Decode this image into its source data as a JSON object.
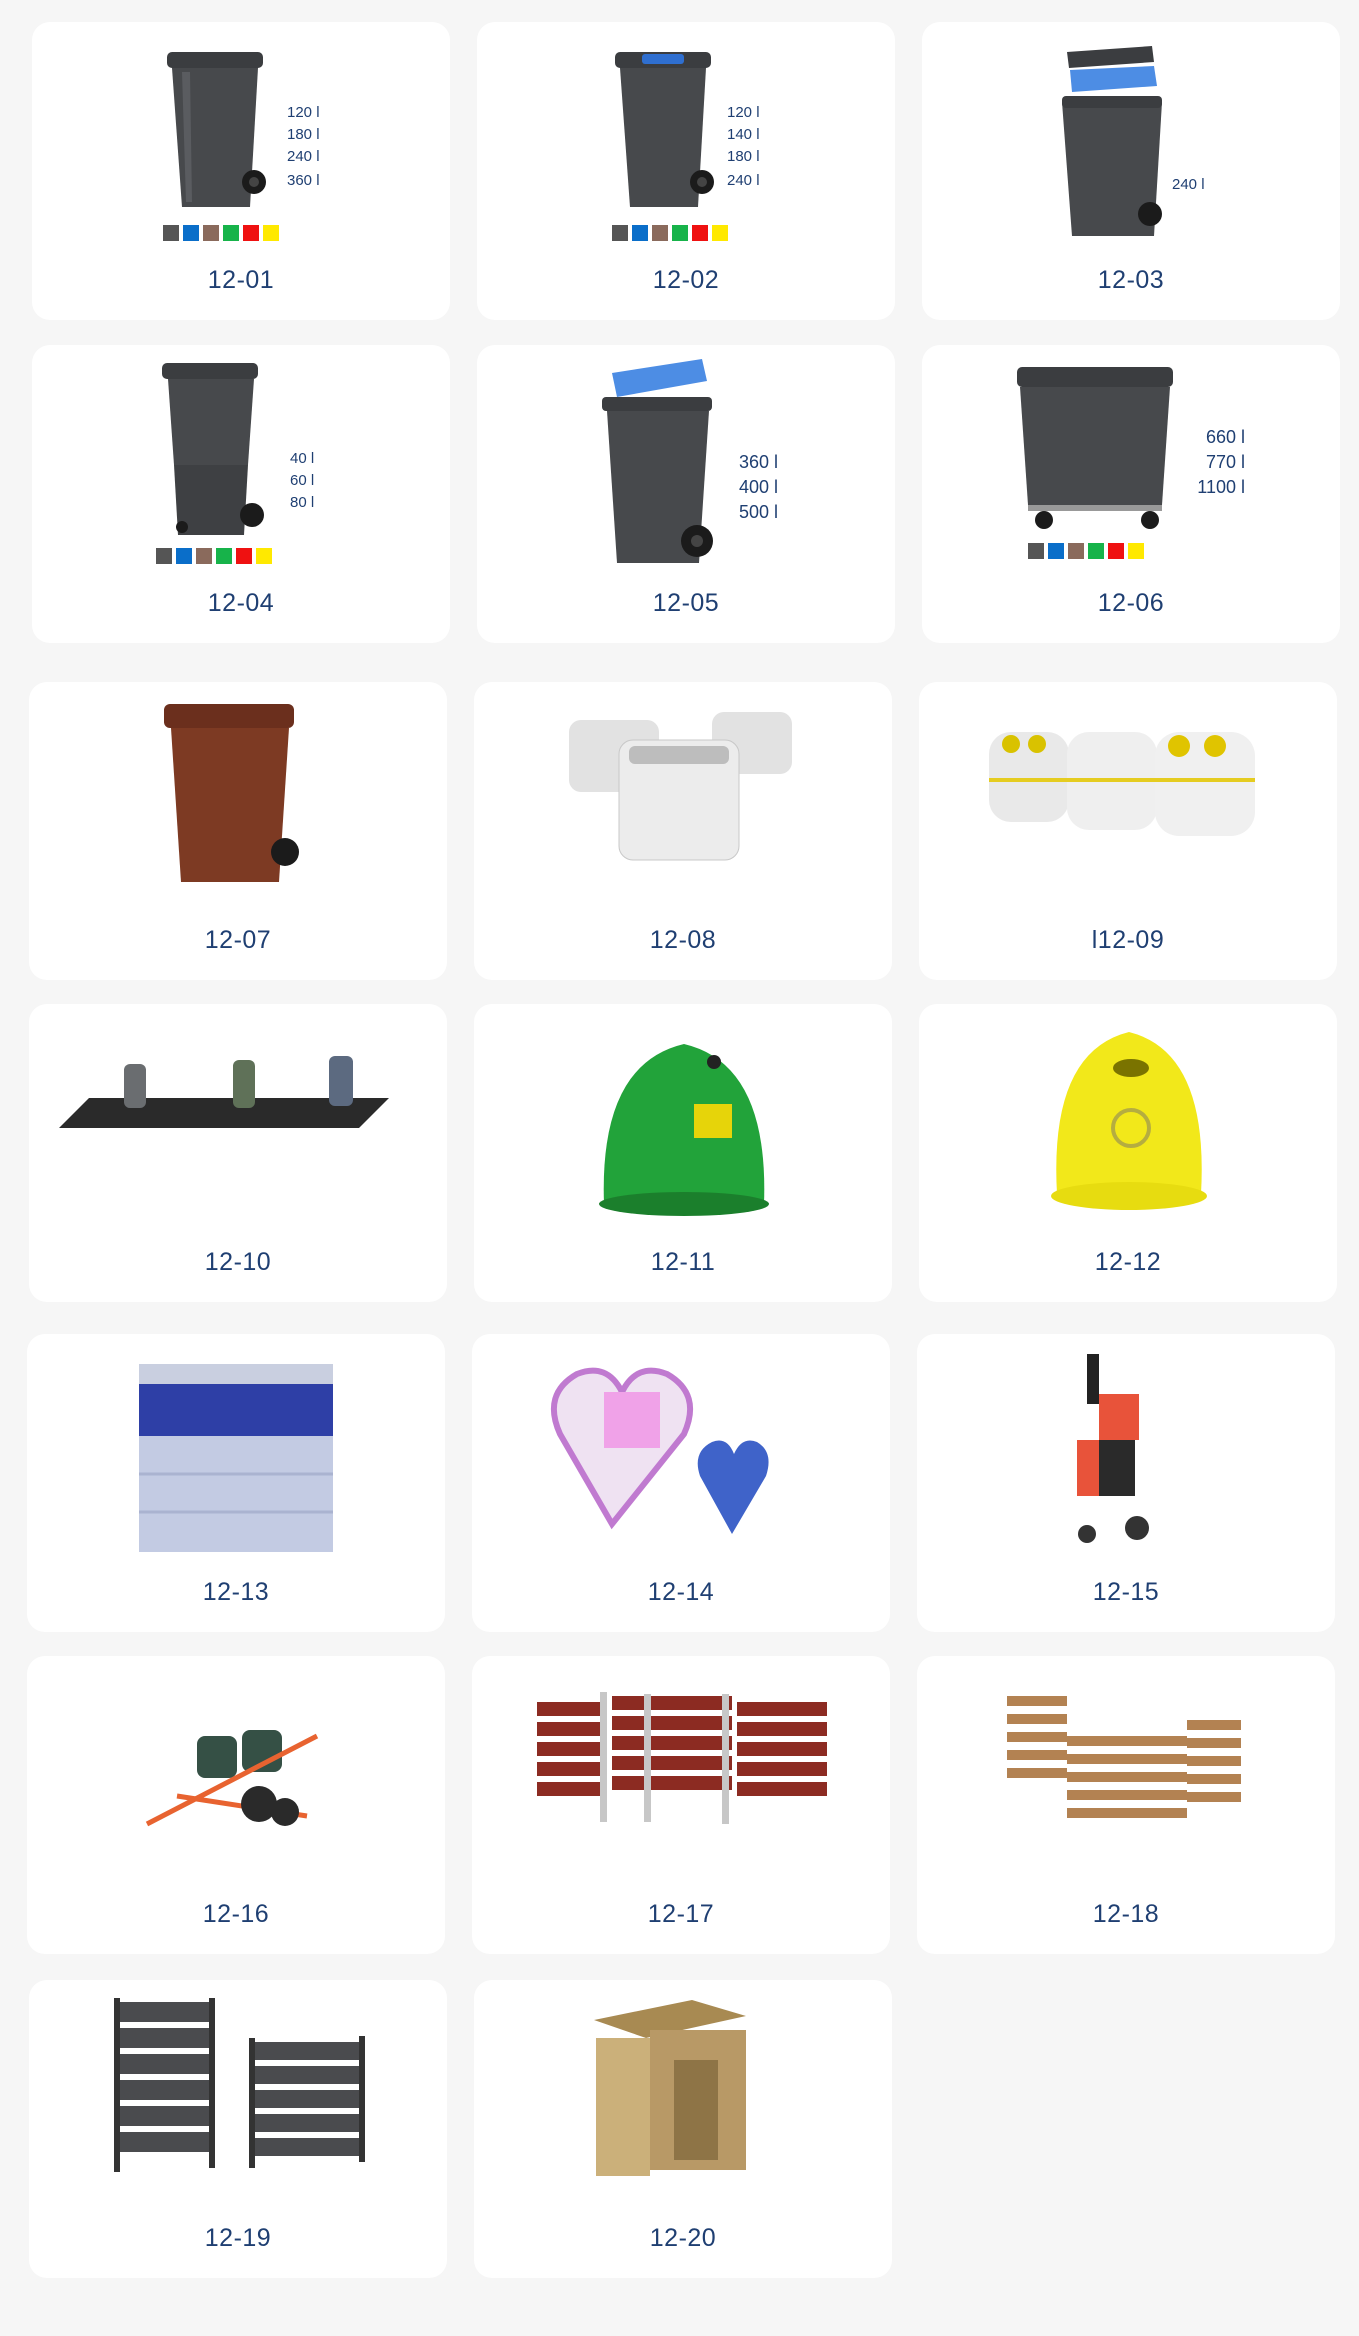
{
  "products": [
    {
      "code": "12-01",
      "capacities": [
        "120 l",
        "180 l",
        "240 l",
        "360 l"
      ],
      "swatches": [
        "#555555",
        "#0a6ec9",
        "#8a6a5c",
        "#17b34a",
        "#ef1111",
        "#ffe900"
      ]
    },
    {
      "code": "12-02",
      "capacities": [
        "120 l",
        "140 l",
        "180 l",
        "240 l"
      ],
      "swatches": [
        "#555555",
        "#0a6ec9",
        "#8a6a5c",
        "#17b34a",
        "#ef1111",
        "#ffe900"
      ]
    },
    {
      "code": "12-03",
      "capacities": [
        "240 l"
      ],
      "swatches": []
    },
    {
      "code": "12-04",
      "capacities": [
        "40 l",
        "60 l",
        "80 l"
      ],
      "swatches": [
        "#555555",
        "#0a6ec9",
        "#8a6a5c",
        "#17b34a",
        "#ef1111",
        "#ffe900"
      ]
    },
    {
      "code": "12-05",
      "capacities": [
        "360 l",
        "400 l",
        "500 l"
      ],
      "swatches": []
    },
    {
      "code": "12-06",
      "capacities": [
        "660 l",
        "770 l",
        "1100 l"
      ],
      "swatches": [
        "#555555",
        "#0a6ec9",
        "#8a6a5c",
        "#17b34a",
        "#ef1111",
        "#ffe900"
      ]
    },
    {
      "code": "12-07",
      "capacities": [],
      "swatches": []
    },
    {
      "code": "12-08",
      "capacities": [],
      "swatches": []
    },
    {
      "code": "l12-09",
      "capacities": [],
      "swatches": []
    },
    {
      "code": "12-10",
      "capacities": [],
      "swatches": []
    },
    {
      "code": "12-11",
      "capacities": [],
      "swatches": []
    },
    {
      "code": "12-12",
      "capacities": [],
      "swatches": []
    },
    {
      "code": "12-13",
      "capacities": [],
      "swatches": []
    },
    {
      "code": "12-14",
      "capacities": [],
      "swatches": []
    },
    {
      "code": "12-15",
      "capacities": [],
      "swatches": []
    },
    {
      "code": "12-16",
      "capacities": [],
      "swatches": []
    },
    {
      "code": "12-17",
      "capacities": [],
      "swatches": []
    },
    {
      "code": "12-18",
      "capacities": [],
      "swatches": []
    },
    {
      "code": "12-19",
      "capacities": [],
      "swatches": []
    },
    {
      "code": "12-20",
      "capacities": [],
      "swatches": []
    }
  ],
  "icons": [
    "wheelie-bin-icon",
    "wheelie-bin-blue-lid-icon",
    "bin-open-lid-icon",
    "small-wheelie-bin-icon",
    "large-bin-blue-lid-icon",
    "container-4-wheel-icon",
    "brown-wheelie-bin-icon",
    "white-containers-icon",
    "igloo-white-yellow-icon",
    "bins-on-platform-icon",
    "green-igloo-icon",
    "yellow-igloo-icon",
    "paper-container-icon",
    "heart-cap-collector-icon",
    "cleaning-cart-icon",
    "double-bin-cart-icon",
    "red-wood-fence-icon",
    "wood-fence-icon",
    "grey-fence-panels-icon",
    "wooden-bin-shed-icon"
  ]
}
